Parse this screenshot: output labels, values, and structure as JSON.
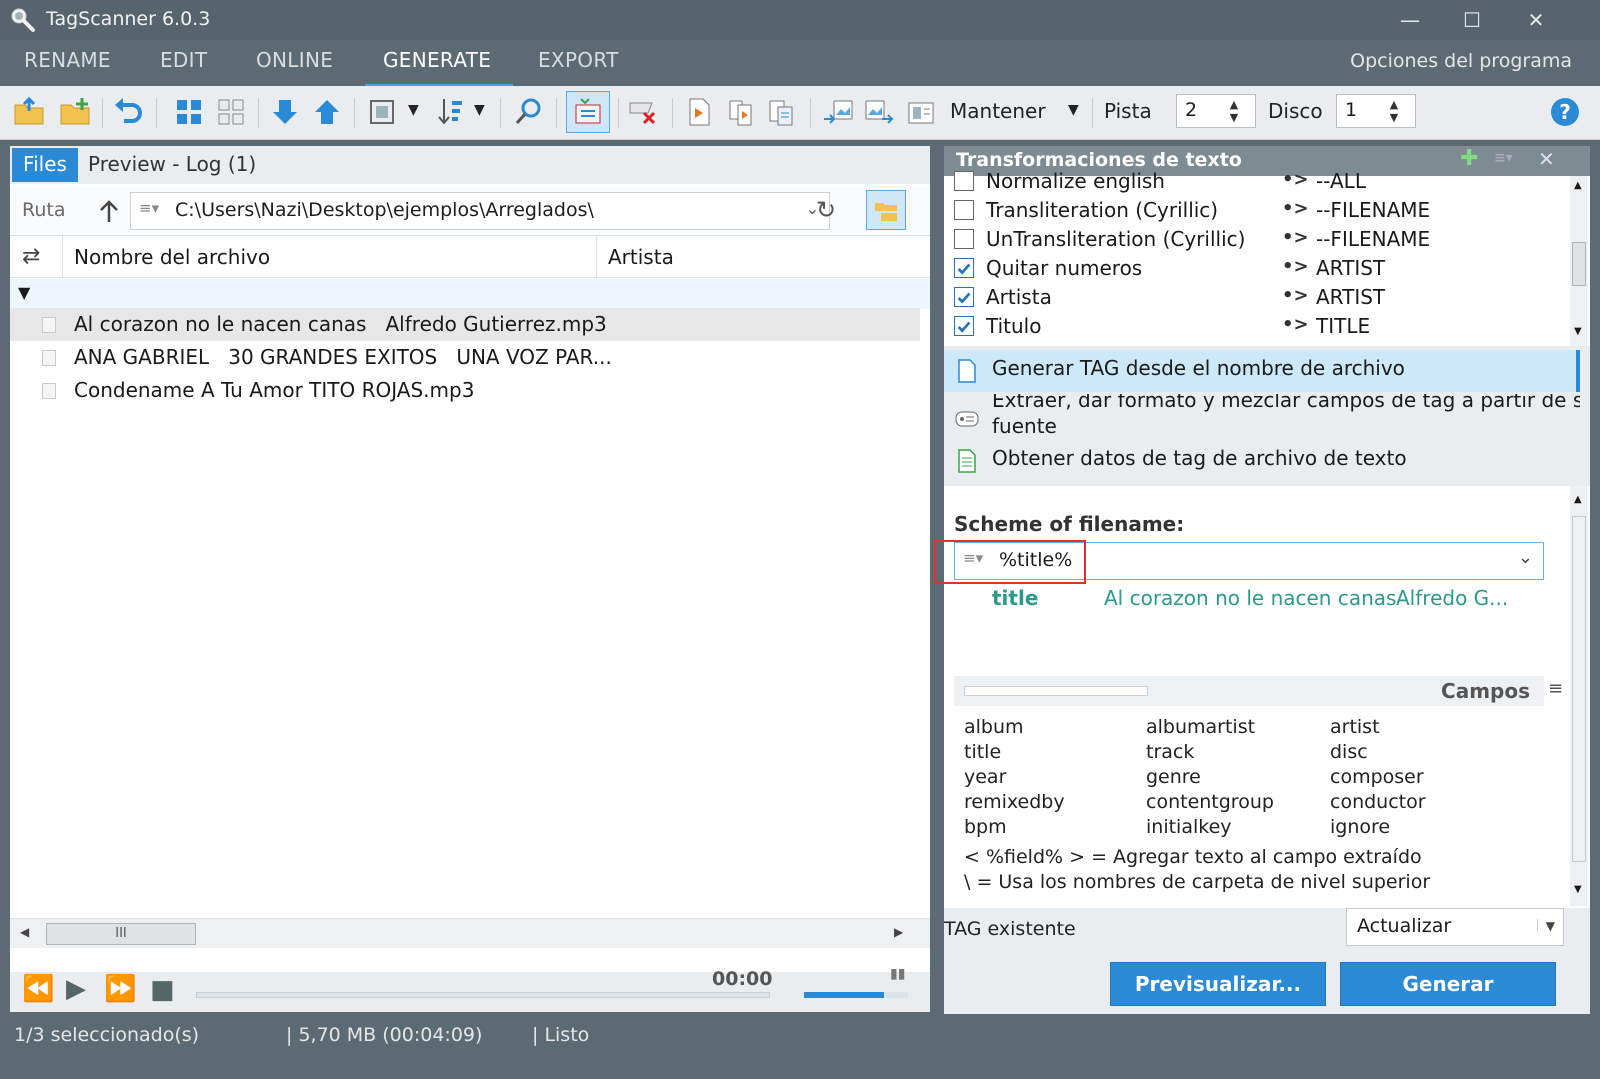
{
  "app": {
    "title": "TagScanner 6.0.3"
  },
  "menu": {
    "items": [
      "RENAME",
      "EDIT",
      "ONLINE",
      "GENERATE",
      "EXPORT"
    ],
    "active": "GENERATE",
    "options": "Opciones del programa"
  },
  "toolbar": {
    "mantener": "Mantener",
    "pista_label": "Pista",
    "pista_value": "2",
    "disco_label": "Disco",
    "disco_value": "1"
  },
  "left": {
    "tab_files": "Files",
    "tab_preview": "Preview - Log (1)",
    "path_label": "Ruta",
    "path_value": "C:\\Users\\Nazi\\Desktop\\ejemplos\\Arreglados\\",
    "col_filename": "Nombre del archivo",
    "col_artist": "Artista",
    "files": [
      {
        "name": "Al corazon no le nacen canas   Alfredo Gutierrez.mp3"
      },
      {
        "name": "ANA GABRIEL   30 GRANDES EXITOS   UNA VOZ PAR..."
      },
      {
        "name": "Condename A Tu Amor TITO ROJAS.mp3"
      }
    ],
    "scroll_grip": "III"
  },
  "player": {
    "time": "00:00"
  },
  "status": {
    "selected": "1/3 seleccionado(s)",
    "size": "| 5,70 MB (00:04:09)",
    "state": "| Listo"
  },
  "right": {
    "header": "Transformaciones de texto",
    "transforms": [
      {
        "name": "Normalize english",
        "target": "--ALL",
        "checked": false
      },
      {
        "name": "Transliteration (Cyrillic)",
        "target": "--FILENAME",
        "checked": false
      },
      {
        "name": "UnTransliteration (Cyrillic)",
        "target": "--FILENAME",
        "checked": false
      },
      {
        "name": "Quitar numeros",
        "target": "ARTIST",
        "checked": true
      },
      {
        "name": "Artista",
        "target": "ARTIST",
        "checked": true
      },
      {
        "name": "Titulo",
        "target": "TITLE",
        "checked": true
      }
    ],
    "arrow": "•>",
    "actions": {
      "generate_from_filename": "Generar TAG desde el nombre de archivo",
      "extract_format_1": "Extraer, dar formato y mezclar campos de tag a partir de string",
      "extract_format_2": "fuente",
      "from_text_file": "Obtener datos de tag de archivo de texto"
    },
    "scheme_label": "Scheme of filename:",
    "scheme_value": "%title%",
    "preview_field": "title",
    "preview_value_1": "Al corazon no le nacen canas",
    "preview_value_2": "Alfredo G...",
    "fields_caption": "Campos",
    "fields": [
      "album",
      "albumartist",
      "artist",
      "title",
      "track",
      "disc",
      "year",
      "genre",
      "composer",
      "remixedby",
      "contentgroup",
      "conductor",
      "bpm",
      "initialkey",
      "ignore"
    ],
    "note_1": "< %field% > = Agregar texto al campo extraído",
    "note_2": "\\ = Usa los nombres de carpeta de nivel superior",
    "existing_tag_label": "TAG existente",
    "existing_tag_value": "Actualizar",
    "btn_preview": "Previsualizar...",
    "btn_generate": "Generar"
  },
  "colors": {
    "accent": "#2b8ad6",
    "titlebar": "#56656d",
    "preview_text": "#2a9a8a",
    "highlight_row": "#cde8f8"
  }
}
